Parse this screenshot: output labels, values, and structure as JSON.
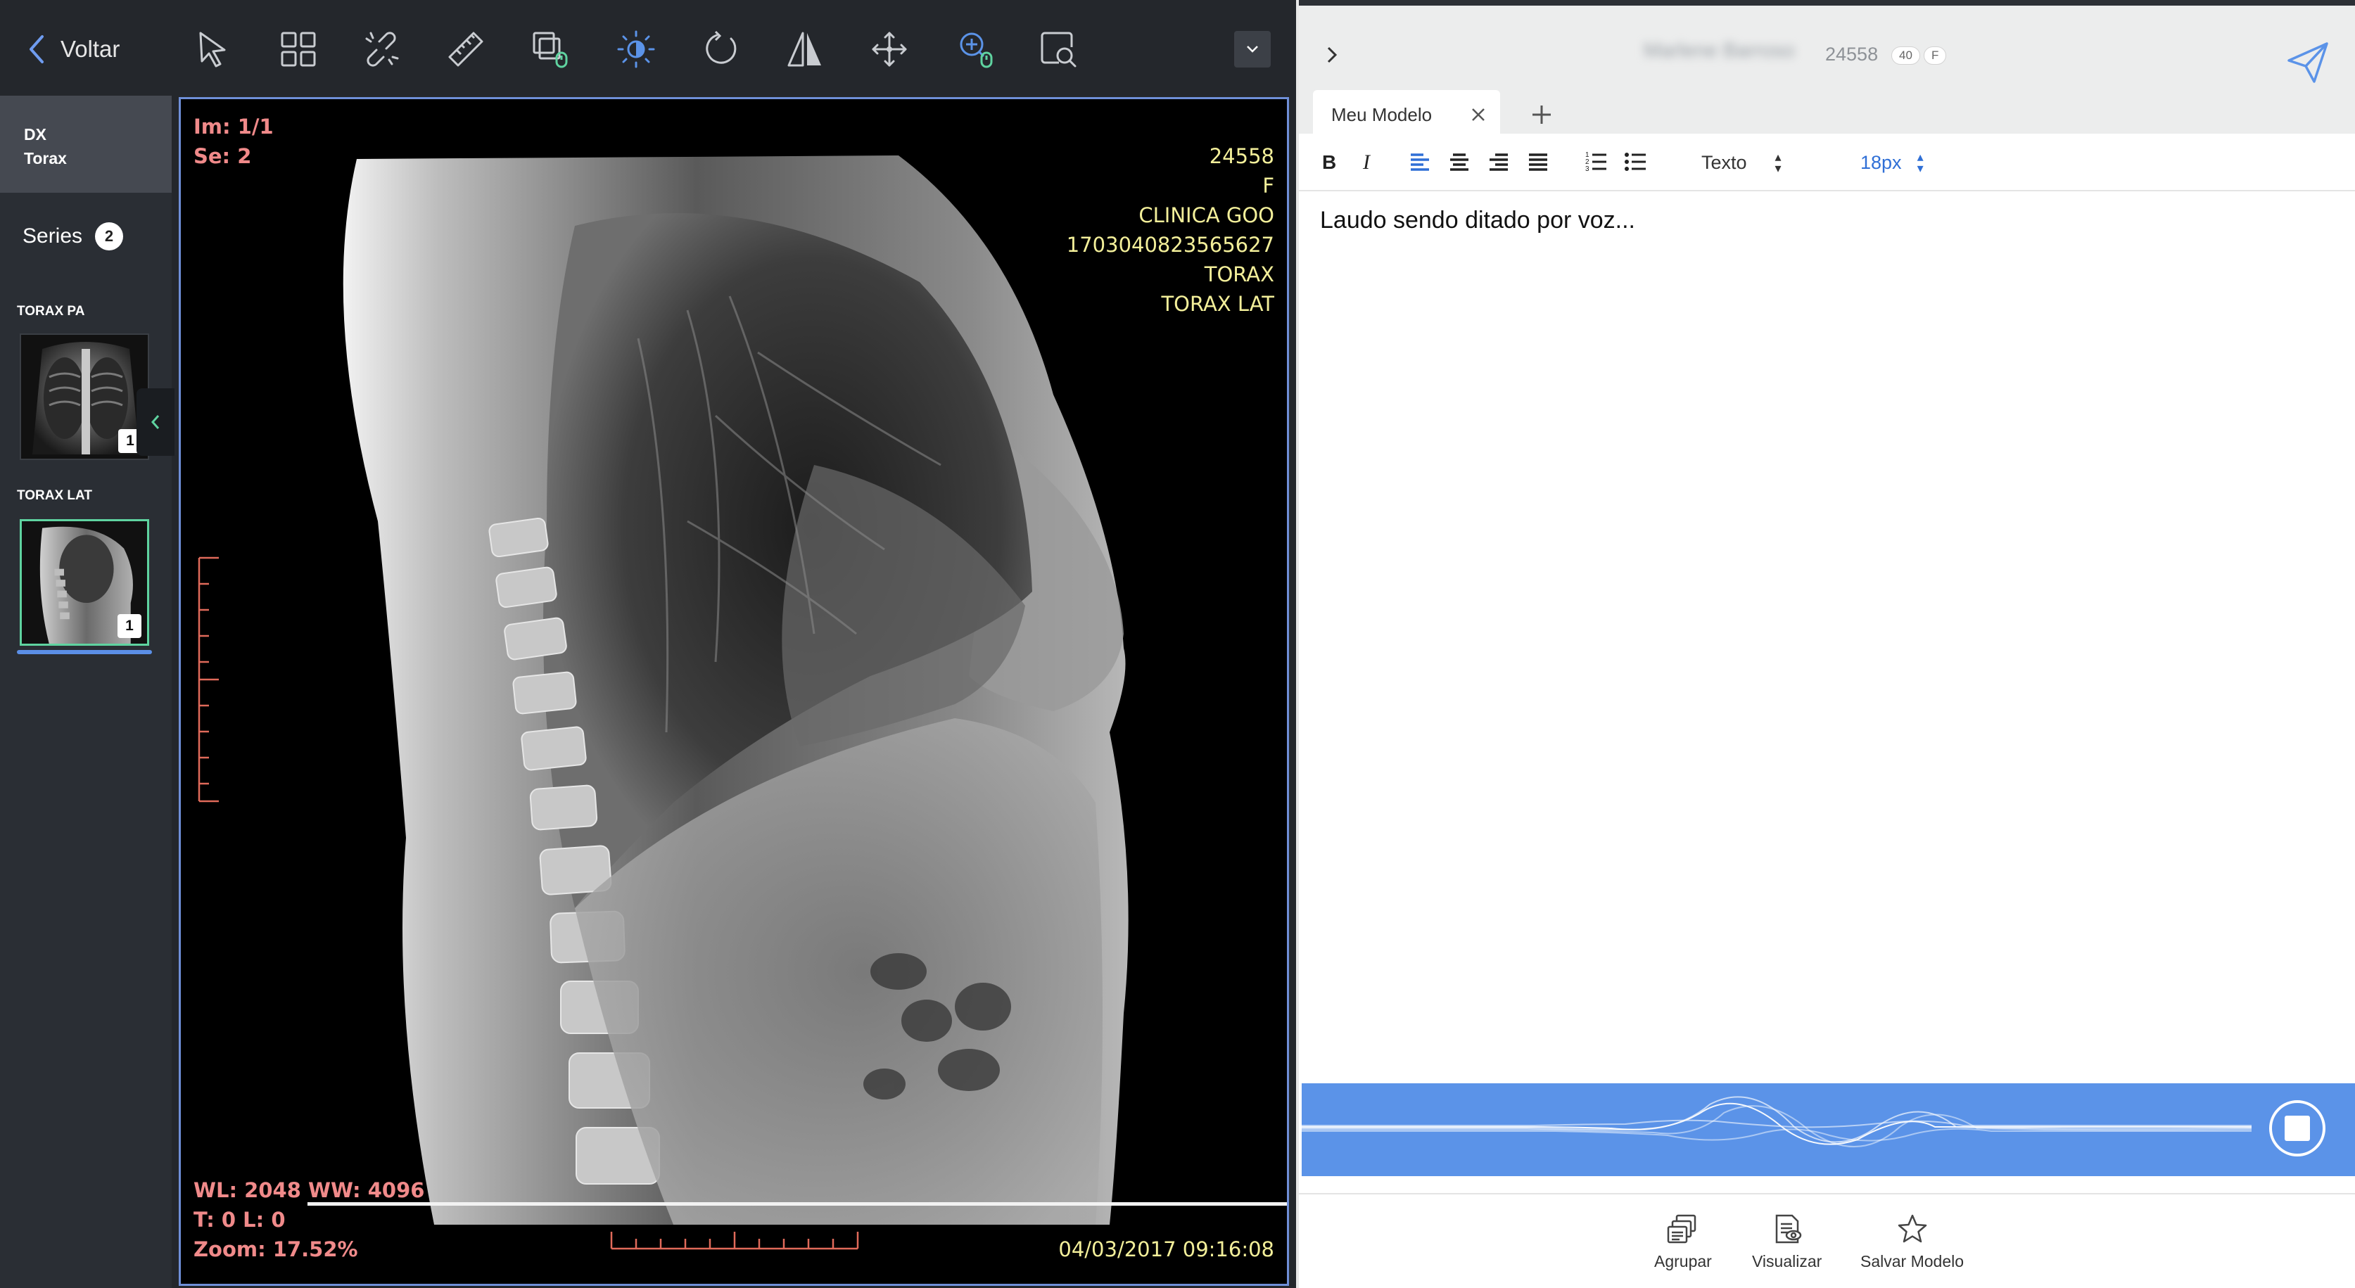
{
  "viewer": {
    "back_label": "Voltar",
    "tools": [
      "pointer-icon",
      "layout-grid-icon",
      "link-off-icon",
      "ruler-icon",
      "stack-scroll-icon",
      "brightness-icon",
      "rotate-icon",
      "flip-icon",
      "pan-icon",
      "zoom-icon",
      "magnify-icon"
    ],
    "sidebar": {
      "modality": "DX",
      "body_part": "Torax",
      "series_label": "Series",
      "series_count": "2",
      "series": [
        {
          "name": "TORAX PA",
          "count": "1"
        },
        {
          "name": "TORAX LAT",
          "count": "1"
        }
      ]
    },
    "overlay": {
      "image_index": "Im: 1/1",
      "series_index": "Se: 2",
      "patient_id": "24558",
      "sex": "F",
      "institution": "CLINICA GOO",
      "accession": "1703040823565627",
      "study": "TORAX",
      "series_desc": "TORAX LAT",
      "window": "WL: 2048 WW: 4096",
      "translate": "T: 0 L: 0",
      "zoom": "Zoom: 17.52%",
      "datetime": "04/03/2017 09:16:08"
    }
  },
  "editor": {
    "patient_name": "Marlene Barroso",
    "patient_id": "24558",
    "age": "40",
    "sex": "F",
    "tab_label": "Meu Modelo",
    "format": {
      "style_select": "Texto",
      "size_select": "18px"
    },
    "content": "Laudo sendo ditado por voz...",
    "footer": {
      "group_label": "Agrupar",
      "preview_label": "Visualizar",
      "save_label": "Salvar Modelo"
    }
  },
  "colors": {
    "accent_blue": "#5b93e8",
    "overlay_red": "#f08a8a",
    "overlay_yellow": "#f3ef9a",
    "active_thumb": "#5fd3a0"
  }
}
